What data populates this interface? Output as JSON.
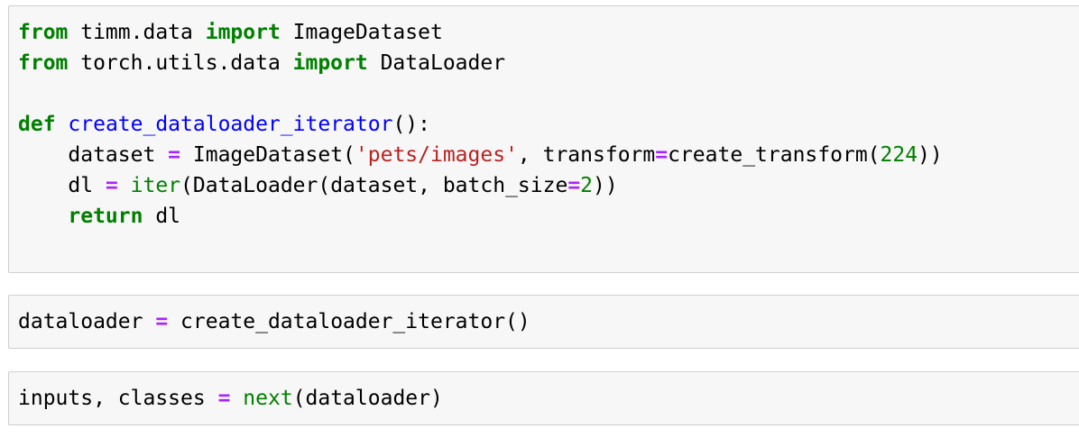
{
  "cells": [
    {
      "lines": [
        [
          [
            "k",
            "from"
          ],
          [
            "p",
            " timm.data "
          ],
          [
            "k",
            "import"
          ],
          [
            "p",
            " ImageDataset"
          ]
        ],
        [
          [
            "k",
            "from"
          ],
          [
            "p",
            " torch.utils.data "
          ],
          [
            "k",
            "import"
          ],
          [
            "p",
            " DataLoader"
          ]
        ],
        [],
        [
          [
            "k",
            "def"
          ],
          [
            "p",
            " "
          ],
          [
            "fn",
            "create_dataloader_iterator"
          ],
          [
            "p",
            "():"
          ]
        ],
        [
          [
            "p",
            "    dataset "
          ],
          [
            "op",
            "="
          ],
          [
            "p",
            " ImageDataset("
          ],
          [
            "s",
            "'pets/images'"
          ],
          [
            "p",
            ", transform"
          ],
          [
            "op",
            "="
          ],
          [
            "p",
            "create_transform("
          ],
          [
            "n",
            "224"
          ],
          [
            "p",
            "))"
          ]
        ],
        [
          [
            "p",
            "    dl "
          ],
          [
            "op",
            "="
          ],
          [
            "p",
            " "
          ],
          [
            "bi",
            "iter"
          ],
          [
            "p",
            "(DataLoader(dataset, batch_size"
          ],
          [
            "op",
            "="
          ],
          [
            "n",
            "2"
          ],
          [
            "p",
            "))"
          ]
        ],
        [
          [
            "p",
            "    "
          ],
          [
            "k",
            "return"
          ],
          [
            "p",
            " dl"
          ]
        ]
      ]
    },
    {
      "lines": [
        [
          [
            "p",
            "dataloader "
          ],
          [
            "op",
            "="
          ],
          [
            "p",
            " create_dataloader_iterator()"
          ]
        ]
      ]
    },
    {
      "lines": [
        [
          [
            "p",
            "inputs, classes "
          ],
          [
            "op",
            "="
          ],
          [
            "p",
            " "
          ],
          [
            "bi",
            "next"
          ],
          [
            "p",
            "(dataloader)"
          ]
        ]
      ]
    }
  ]
}
